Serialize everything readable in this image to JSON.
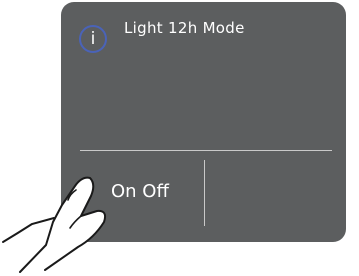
{
  "panel": {
    "title": "Light 12h Mode",
    "info_icon_glyph": "i",
    "background": "#5c5e5f",
    "accent": "#4a63b8"
  },
  "buttons": {
    "onoff_label": "On Off"
  },
  "illustration": {
    "icon": "pointing-hand-icon"
  }
}
